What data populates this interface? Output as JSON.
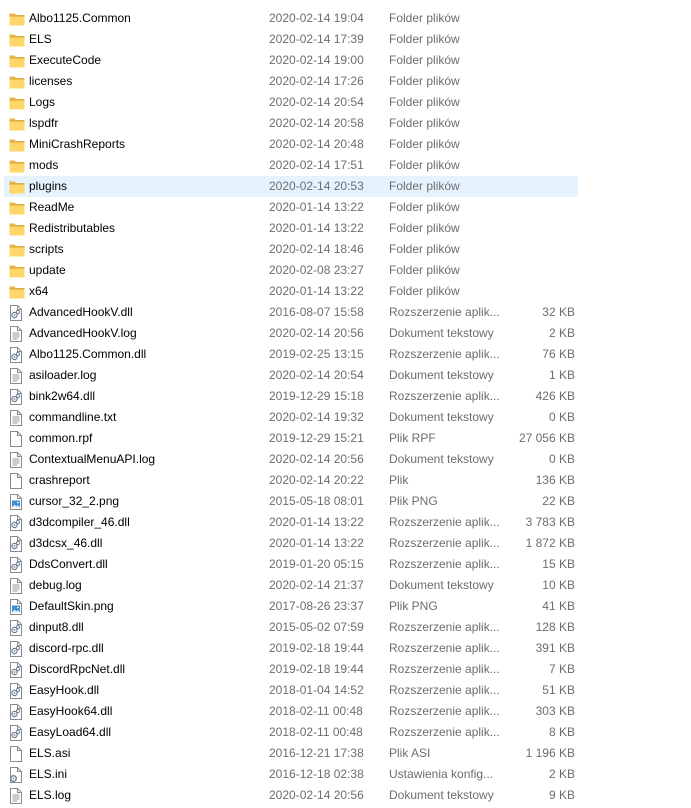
{
  "folder_type": "Folder plików",
  "selected_index": 8,
  "files": [
    {
      "name": "Albo1125.Common",
      "date": "2020-02-14 19:04",
      "type": "Folder plików",
      "size": "",
      "icon": "folder-icon"
    },
    {
      "name": "ELS",
      "date": "2020-02-14 17:39",
      "type": "Folder plików",
      "size": "",
      "icon": "folder-icon"
    },
    {
      "name": "ExecuteCode",
      "date": "2020-02-14 19:00",
      "type": "Folder plików",
      "size": "",
      "icon": "folder-icon"
    },
    {
      "name": "licenses",
      "date": "2020-02-14 17:26",
      "type": "Folder plików",
      "size": "",
      "icon": "folder-icon"
    },
    {
      "name": "Logs",
      "date": "2020-02-14 20:54",
      "type": "Folder plików",
      "size": "",
      "icon": "folder-icon"
    },
    {
      "name": "lspdfr",
      "date": "2020-02-14 20:58",
      "type": "Folder plików",
      "size": "",
      "icon": "folder-icon"
    },
    {
      "name": "MiniCrashReports",
      "date": "2020-02-14 20:48",
      "type": "Folder plików",
      "size": "",
      "icon": "folder-icon"
    },
    {
      "name": "mods",
      "date": "2020-02-14 17:51",
      "type": "Folder plików",
      "size": "",
      "icon": "folder-icon"
    },
    {
      "name": "plugins",
      "date": "2020-02-14 20:53",
      "type": "Folder plików",
      "size": "",
      "icon": "folder-icon"
    },
    {
      "name": "ReadMe",
      "date": "2020-01-14 13:22",
      "type": "Folder plików",
      "size": "",
      "icon": "folder-icon"
    },
    {
      "name": "Redistributables",
      "date": "2020-01-14 13:22",
      "type": "Folder plików",
      "size": "",
      "icon": "folder-icon"
    },
    {
      "name": "scripts",
      "date": "2020-02-14 18:46",
      "type": "Folder plików",
      "size": "",
      "icon": "folder-icon"
    },
    {
      "name": "update",
      "date": "2020-02-08 23:27",
      "type": "Folder plików",
      "size": "",
      "icon": "folder-icon"
    },
    {
      "name": "x64",
      "date": "2020-01-14 13:22",
      "type": "Folder plików",
      "size": "",
      "icon": "folder-icon"
    },
    {
      "name": "AdvancedHookV.dll",
      "date": "2016-08-07 15:58",
      "type": "Rozszerzenie aplik...",
      "size": "32 KB",
      "icon": "dll-file-icon"
    },
    {
      "name": "AdvancedHookV.log",
      "date": "2020-02-14 20:56",
      "type": "Dokument tekstowy",
      "size": "2 KB",
      "icon": "text-file-icon"
    },
    {
      "name": "Albo1125.Common.dll",
      "date": "2019-02-25 13:15",
      "type": "Rozszerzenie aplik...",
      "size": "76 KB",
      "icon": "dll-file-icon"
    },
    {
      "name": "asiloader.log",
      "date": "2020-02-14 20:54",
      "type": "Dokument tekstowy",
      "size": "1 KB",
      "icon": "text-file-icon"
    },
    {
      "name": "bink2w64.dll",
      "date": "2019-12-29 15:18",
      "type": "Rozszerzenie aplik...",
      "size": "426 KB",
      "icon": "dll-file-icon"
    },
    {
      "name": "commandline.txt",
      "date": "2020-02-14 19:32",
      "type": "Dokument tekstowy",
      "size": "0 KB",
      "icon": "text-file-icon"
    },
    {
      "name": "common.rpf",
      "date": "2019-12-29 15:21",
      "type": "Plik RPF",
      "size": "27 056 KB",
      "icon": "file-icon"
    },
    {
      "name": "ContextualMenuAPI.log",
      "date": "2020-02-14 20:56",
      "type": "Dokument tekstowy",
      "size": "0 KB",
      "icon": "text-file-icon"
    },
    {
      "name": "crashreport",
      "date": "2020-02-14 20:22",
      "type": "Plik",
      "size": "136 KB",
      "icon": "file-icon"
    },
    {
      "name": "cursor_32_2.png",
      "date": "2015-05-18 08:01",
      "type": "Plik PNG",
      "size": "22 KB",
      "icon": "image-file-icon"
    },
    {
      "name": "d3dcompiler_46.dll",
      "date": "2020-01-14 13:22",
      "type": "Rozszerzenie aplik...",
      "size": "3 783 KB",
      "icon": "dll-file-icon"
    },
    {
      "name": "d3dcsx_46.dll",
      "date": "2020-01-14 13:22",
      "type": "Rozszerzenie aplik...",
      "size": "1 872 KB",
      "icon": "dll-file-icon"
    },
    {
      "name": "DdsConvert.dll",
      "date": "2019-01-20 05:15",
      "type": "Rozszerzenie aplik...",
      "size": "15 KB",
      "icon": "dll-file-icon"
    },
    {
      "name": "debug.log",
      "date": "2020-02-14 21:37",
      "type": "Dokument tekstowy",
      "size": "10 KB",
      "icon": "text-file-icon"
    },
    {
      "name": "DefaultSkin.png",
      "date": "2017-08-26 23:37",
      "type": "Plik PNG",
      "size": "41 KB",
      "icon": "image-file-icon"
    },
    {
      "name": "dinput8.dll",
      "date": "2015-05-02 07:59",
      "type": "Rozszerzenie aplik...",
      "size": "128 KB",
      "icon": "dll-file-icon"
    },
    {
      "name": "discord-rpc.dll",
      "date": "2019-02-18 19:44",
      "type": "Rozszerzenie aplik...",
      "size": "391 KB",
      "icon": "dll-file-icon"
    },
    {
      "name": "DiscordRpcNet.dll",
      "date": "2019-02-18 19:44",
      "type": "Rozszerzenie aplik...",
      "size": "7 KB",
      "icon": "dll-file-icon"
    },
    {
      "name": "EasyHook.dll",
      "date": "2018-01-04 14:52",
      "type": "Rozszerzenie aplik...",
      "size": "51 KB",
      "icon": "dll-file-icon"
    },
    {
      "name": "EasyHook64.dll",
      "date": "2018-02-11 00:48",
      "type": "Rozszerzenie aplik...",
      "size": "303 KB",
      "icon": "dll-file-icon"
    },
    {
      "name": "EasyLoad64.dll",
      "date": "2018-02-11 00:48",
      "type": "Rozszerzenie aplik...",
      "size": "8 KB",
      "icon": "dll-file-icon"
    },
    {
      "name": "ELS.asi",
      "date": "2016-12-21 17:38",
      "type": "Plik ASI",
      "size": "1 196 KB",
      "icon": "file-icon"
    },
    {
      "name": "ELS.ini",
      "date": "2016-12-18 02:38",
      "type": "Ustawienia konfig...",
      "size": "2 KB",
      "icon": "settings-file-icon"
    },
    {
      "name": "ELS.log",
      "date": "2020-02-14 20:56",
      "type": "Dokument tekstowy",
      "size": "9 KB",
      "icon": "text-file-icon"
    }
  ]
}
